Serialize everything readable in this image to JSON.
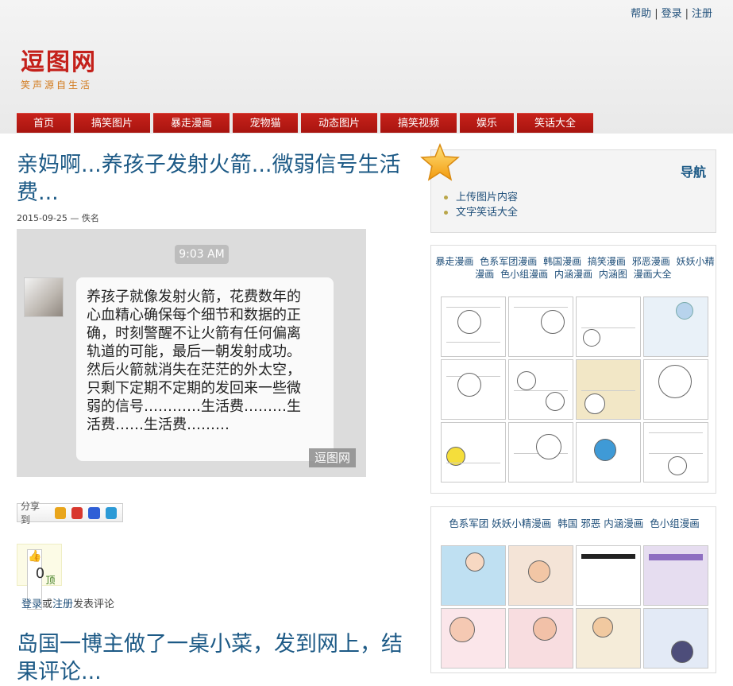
{
  "header": {
    "links": [
      "帮助",
      "登录",
      "注册"
    ],
    "logo_title": "逗图网",
    "logo_slogan": "笑声源自生活"
  },
  "nav": {
    "items": [
      "首页",
      "搞笑图片",
      "暴走漫画",
      "宠物猫",
      "动态图片",
      "搞笑视频",
      "娱乐",
      "笑话大全"
    ]
  },
  "post": {
    "title": "亲妈啊...养孩子发射火箭...微弱信号生活费...",
    "meta": "2015-09-25 — 佚名",
    "image": {
      "time": "9:03 AM",
      "text": "养孩子就像发射火箭，花费数年的心血精心确保每个细节和数据的正确，时刻警醒不让火箭有任何偏离轨道的可能，最后一朝发射成功。然后火箭就消失在茫茫的外太空，只剩下定期不定期的发回来一些微弱的信号…………生活费………生活费……生活费………",
      "watermark": "逗图网"
    },
    "share_label": "分享到",
    "vote_label": "顶",
    "vote_count": "0",
    "comment": {
      "login": "登录",
      "or": "或",
      "register": "注册",
      "suffix": "发表评论"
    },
    "next_title": "岛国一博主做了一桌小菜，发到网上，结果评论..."
  },
  "sidebar": {
    "nav_box": {
      "title": "导航",
      "items": [
        "上传图片内容",
        "文字笑话大全"
      ]
    },
    "card1": {
      "links": [
        "暴走漫画",
        "色系军团漫画",
        "韩国漫画",
        "搞笑漫画",
        "邪恶漫画",
        "妖妖小精漫画",
        "色小组漫画",
        "内涵漫画",
        "内涵图",
        "漫画大全"
      ]
    },
    "card2": {
      "links": [
        "色系军团",
        "妖妖小精漫画",
        "韩国",
        "邪恶",
        "内涵漫画",
        "色小组漫画"
      ]
    }
  },
  "colors": {
    "nav_red": "#b51a13",
    "link_blue": "#1d5a86"
  }
}
